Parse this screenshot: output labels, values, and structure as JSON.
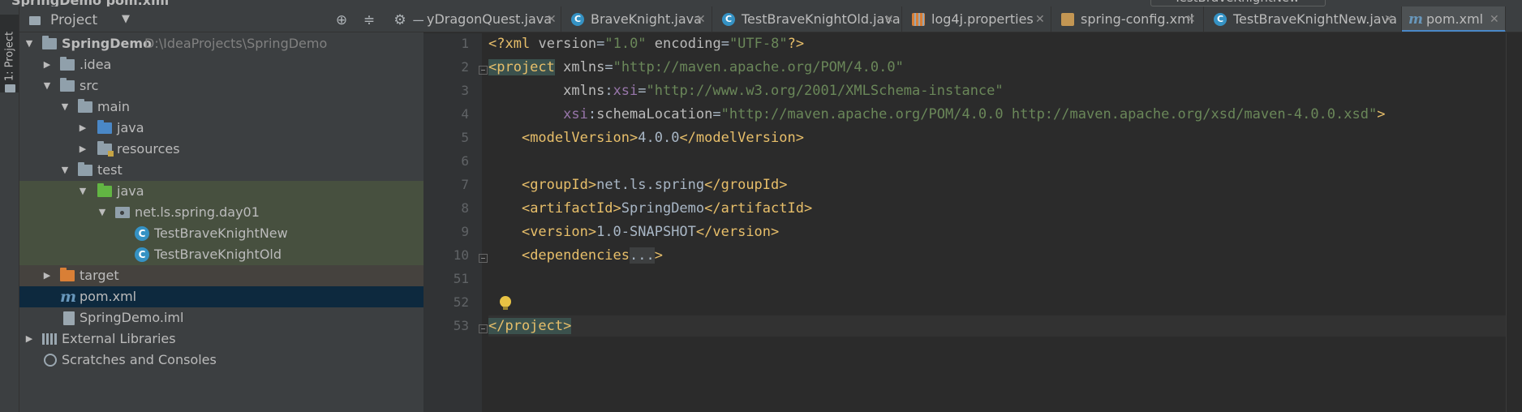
{
  "titlebar": {
    "breadcrumb": "SpringDemo  pom.xml",
    "run_config": "TestBraveKnightNew"
  },
  "left_stripe": {
    "project_tab": "1: Project"
  },
  "project_panel": {
    "title": "Project",
    "tree": {
      "root_name": "SpringDemo",
      "root_path": "D:\\IdeaProjects\\SpringDemo",
      "idea": ".idea",
      "src": "src",
      "main": "main",
      "main_java": "java",
      "resources": "resources",
      "test": "test",
      "test_java": "java",
      "package": "net.ls.spring.day01",
      "class_new": "TestBraveKnightNew",
      "class_old": "TestBraveKnightOld",
      "target": "target",
      "pom": "pom.xml",
      "iml": "SpringDemo.iml",
      "external_libraries": "External Libraries",
      "scratches": "Scratches and Consoles"
    }
  },
  "tabs": [
    {
      "label": "yDragonQuest.java"
    },
    {
      "label": "BraveKnight.java"
    },
    {
      "label": "TestBraveKnightOld.java"
    },
    {
      "label": "log4j.properties"
    },
    {
      "label": "spring-config.xml"
    },
    {
      "label": "TestBraveKnightNew.java"
    },
    {
      "label": "pom.xml"
    }
  ],
  "editor": {
    "line_numbers": [
      "1",
      "2",
      "3",
      "4",
      "5",
      "6",
      "7",
      "8",
      "9",
      "10",
      "51",
      "52",
      "53"
    ],
    "code": {
      "l1_open": "<?",
      "l1_tag": "xml",
      "l1_attr1": "version",
      "l1_val1": "\"1.0\"",
      "l1_attr2": "encoding",
      "l1_val2": "\"UTF-8\"",
      "l1_close": "?>",
      "l2_tag": "<project",
      "l2_attr": "xmlns",
      "l2_val": "\"http://maven.apache.org/POM/4.0.0\"",
      "l3_attr": "xmlns",
      "l3_ns": "xsi",
      "l3_val": "\"http://www.w3.org/2001/XMLSchema-instance\"",
      "l4_ns": "xsi",
      "l4_attr": "schemaLocation",
      "l4_val": "\"http://maven.apache.org/POM/4.0.0 http://maven.apache.org/xsd/maven-4.0.0.xsd\"",
      "l4_close": ">",
      "l5_open": "<modelVersion>",
      "l5_text": "4.0.0",
      "l5_close": "</modelVersion>",
      "l7_open": "<groupId>",
      "l7_text": "net.ls.spring",
      "l7_close": "</groupId>",
      "l8_open": "<artifactId>",
      "l8_text": "SpringDemo",
      "l8_close": "</artifactId>",
      "l9_open": "<version>",
      "l9_text": "1.0-SNAPSHOT",
      "l9_close": "</version>",
      "l10_open": "<dependencies",
      "l10_fold": "...",
      "l10_close": ">",
      "l53_close": "</project>"
    }
  },
  "colors": {
    "tag": "#e8bf6a",
    "string": "#6a8759",
    "namespace": "#9876aa",
    "accent": "#4a88c7",
    "selection": "#0d293e"
  }
}
